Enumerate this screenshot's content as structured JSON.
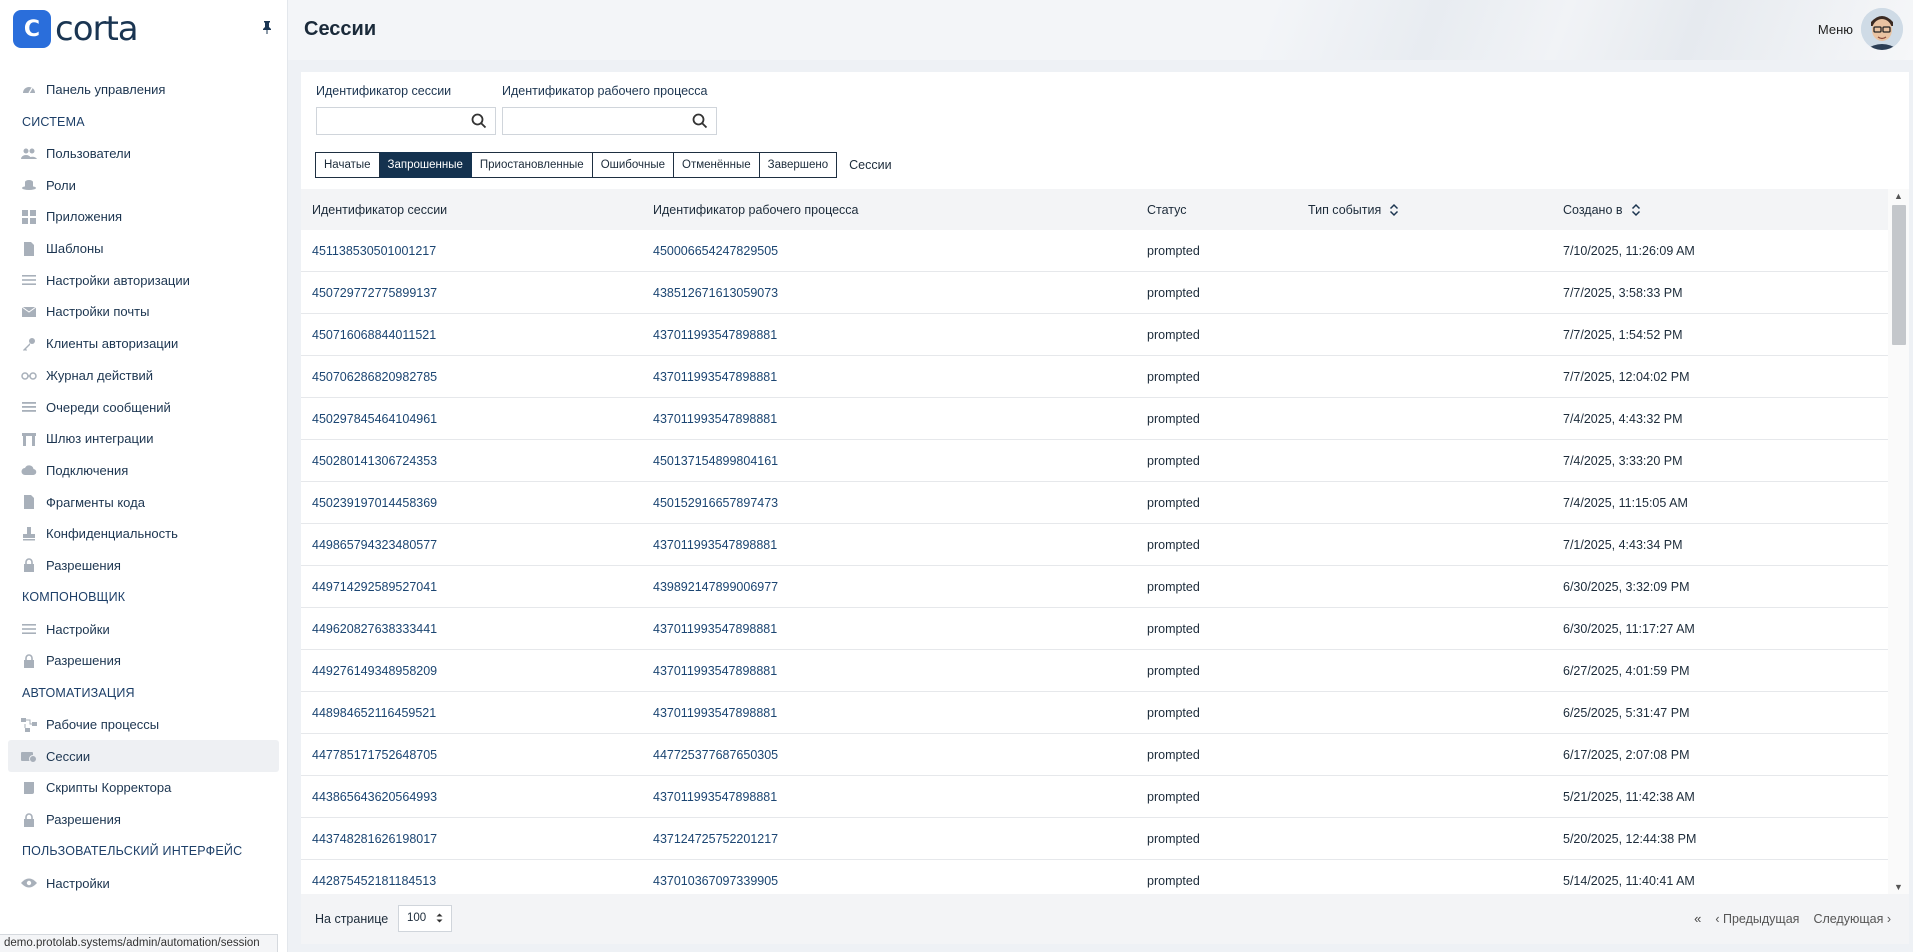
{
  "app": {
    "logo_glyph": "C",
    "logo_text": "corta",
    "page_title": "Сессии",
    "menu_label": "Меню",
    "status_url": "demo.protolab.systems/admin/automation/session"
  },
  "colors": {
    "brand": "#2a6edb",
    "navy": "#14324f",
    "link": "#1b4572"
  },
  "sidebar": {
    "dashboard": {
      "label": "Панель управления",
      "icon": "dashboard-icon"
    },
    "sections": [
      {
        "title": "СИСТЕМА",
        "items": [
          {
            "label": "Пользователи",
            "icon": "users-icon"
          },
          {
            "label": "Роли",
            "icon": "hat-icon"
          },
          {
            "label": "Приложения",
            "icon": "apps-grid-icon"
          },
          {
            "label": "Шаблоны",
            "icon": "file-icon"
          },
          {
            "label": "Настройки авторизации",
            "icon": "sliders-icon"
          },
          {
            "label": "Настройки почты",
            "icon": "mail-icon"
          },
          {
            "label": "Клиенты авторизации",
            "icon": "key-icon"
          },
          {
            "label": "Журнал действий",
            "icon": "glasses-icon"
          },
          {
            "label": "Очереди сообщений",
            "icon": "list-icon"
          },
          {
            "label": "Шлюз интеграции",
            "icon": "gateway-icon"
          },
          {
            "label": "Подключения",
            "icon": "cloud-icon"
          },
          {
            "label": "Фрагменты кода",
            "icon": "code-file-icon"
          },
          {
            "label": "Конфиденциальность",
            "icon": "stamp-icon"
          },
          {
            "label": "Разрешения",
            "icon": "lock-icon"
          }
        ]
      },
      {
        "title": "КОМПОНОВЩИК",
        "items": [
          {
            "label": "Настройки",
            "icon": "sliders-icon"
          },
          {
            "label": "Разрешения",
            "icon": "lock-icon"
          }
        ]
      },
      {
        "title": "АВТОМАТИЗАЦИЯ",
        "items": [
          {
            "label": "Рабочие процессы",
            "icon": "workflow-icon"
          },
          {
            "label": "Сессии",
            "icon": "sessions-icon",
            "active": true
          },
          {
            "label": "Скрипты Корректора",
            "icon": "script-icon"
          },
          {
            "label": "Разрешения",
            "icon": "lock-icon"
          }
        ]
      },
      {
        "title": "ПОЛЬЗОВАТЕЛЬСКИЙ ИНТЕРФЕЙС",
        "items": [
          {
            "label": "Настройки",
            "icon": "eye-icon"
          }
        ]
      }
    ]
  },
  "filters": {
    "session_id_label": "Идентификатор сессии",
    "session_id_value": "",
    "workflow_id_label": "Идентификатор рабочего процесса",
    "workflow_id_value": ""
  },
  "tabs": {
    "items": [
      "Начатые",
      "Запрошенные",
      "Приостановленные",
      "Ошибочные",
      "Отменённые",
      "Завершено"
    ],
    "active_index": 1,
    "caption": "Сессии"
  },
  "table": {
    "headers": [
      "Идентификатор сессии",
      "Идентификатор рабочего процесса",
      "Статус",
      "Тип события",
      "Создано в"
    ],
    "rows": [
      [
        "451138530501001217",
        "450006654247829505",
        "prompted",
        "",
        "7/10/2025, 11:26:09 AM"
      ],
      [
        "450729772775899137",
        "438512671613059073",
        "prompted",
        "",
        "7/7/2025, 3:58:33 PM"
      ],
      [
        "450716068844011521",
        "437011993547898881",
        "prompted",
        "",
        "7/7/2025, 1:54:52 PM"
      ],
      [
        "450706286820982785",
        "437011993547898881",
        "prompted",
        "",
        "7/7/2025, 12:04:02 PM"
      ],
      [
        "450297845464104961",
        "437011993547898881",
        "prompted",
        "",
        "7/4/2025, 4:43:32 PM"
      ],
      [
        "450280141306724353",
        "450137154899804161",
        "prompted",
        "",
        "7/4/2025, 3:33:20 PM"
      ],
      [
        "450239197014458369",
        "450152916657897473",
        "prompted",
        "",
        "7/4/2025, 11:15:05 AM"
      ],
      [
        "449865794323480577",
        "437011993547898881",
        "prompted",
        "",
        "7/1/2025, 4:43:34 PM"
      ],
      [
        "449714292589527041",
        "439892147899006977",
        "prompted",
        "",
        "6/30/2025, 3:32:09 PM"
      ],
      [
        "449620827638333441",
        "437011993547898881",
        "prompted",
        "",
        "6/30/2025, 11:17:27 AM"
      ],
      [
        "449276149348958209",
        "437011993547898881",
        "prompted",
        "",
        "6/27/2025, 4:01:59 PM"
      ],
      [
        "448984652116459521",
        "437011993547898881",
        "prompted",
        "",
        "6/25/2025, 5:31:47 PM"
      ],
      [
        "447785171752648705",
        "447725377687650305",
        "prompted",
        "",
        "6/17/2025, 2:07:08 PM"
      ],
      [
        "443865643620564993",
        "437011993547898881",
        "prompted",
        "",
        "5/21/2025, 11:42:38 AM"
      ],
      [
        "443748281626198017",
        "437124725752201217",
        "prompted",
        "",
        "5/20/2025, 12:44:38 PM"
      ],
      [
        "442875452181184513",
        "437010367097339905",
        "prompted",
        "",
        "5/14/2025, 11:40:41 AM"
      ]
    ]
  },
  "pager": {
    "per_page_label": "На странице",
    "per_page_value": "100",
    "first_glyph": "«",
    "prev_label": "‹ Предыдущая",
    "next_label": "Следующая ›"
  }
}
